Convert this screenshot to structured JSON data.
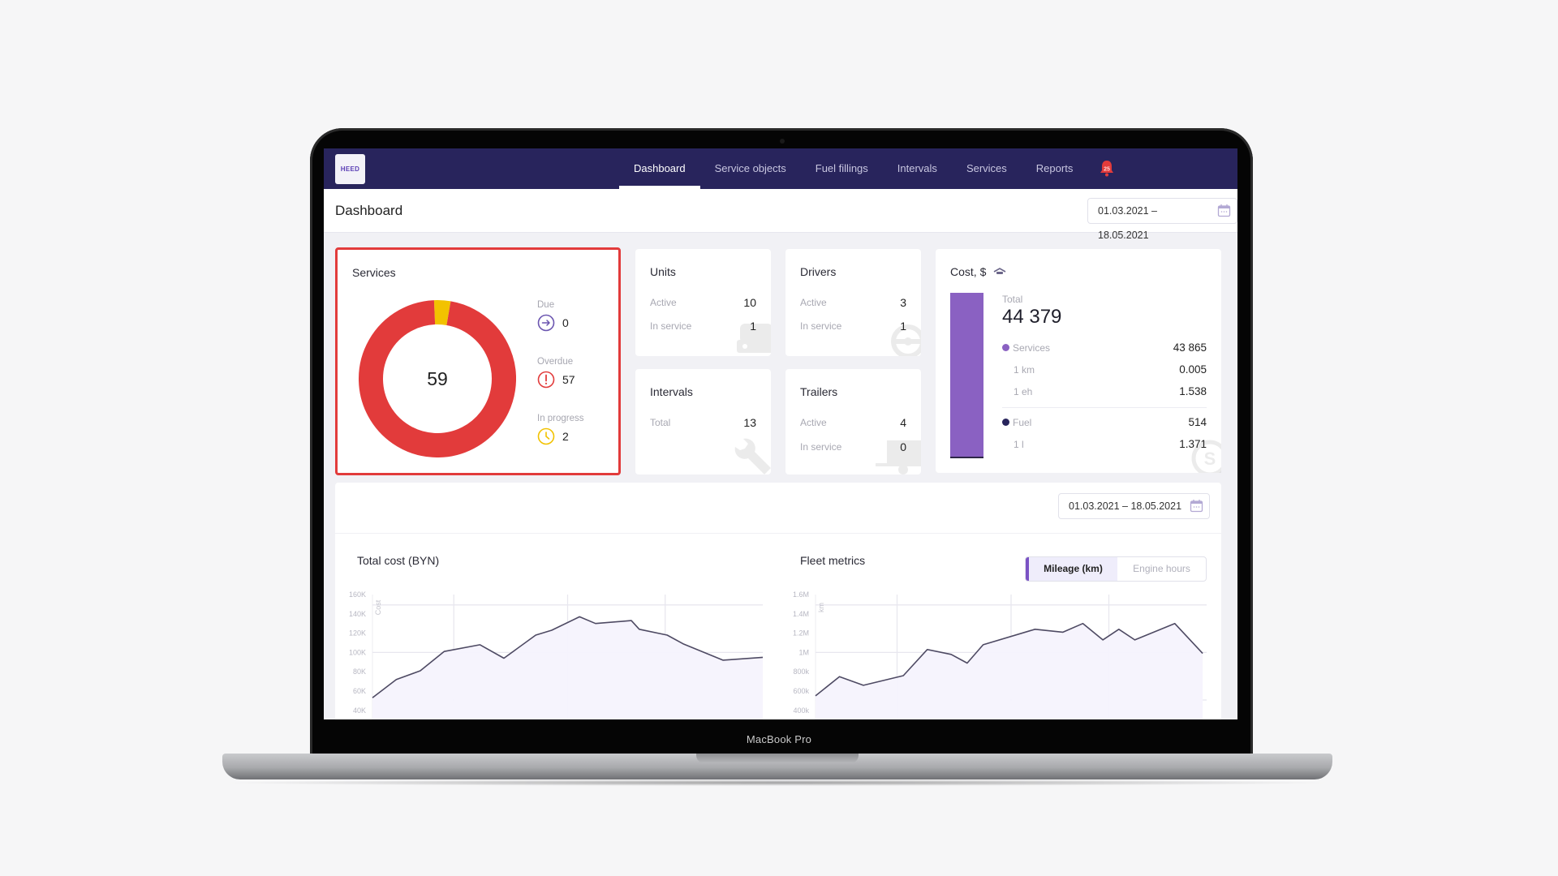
{
  "device": {
    "label": "MacBook Pro"
  },
  "app": {
    "logo_text": "HEED",
    "nav": [
      {
        "label": "Dashboard",
        "active": true
      },
      {
        "label": "Service objects",
        "active": false
      },
      {
        "label": "Fuel fillings",
        "active": false
      },
      {
        "label": "Intervals",
        "active": false
      },
      {
        "label": "Services",
        "active": false
      },
      {
        "label": "Reports",
        "active": false
      }
    ],
    "notifications": {
      "icon": "bell-icon",
      "count": "25"
    },
    "page_title": "Dashboard",
    "date_range": "01.03.2021 – 18.05.2021"
  },
  "services": {
    "title": "Services",
    "total": "59",
    "due": {
      "label": "Due",
      "value": "0",
      "icon": "arrow-right-circle-icon",
      "color": "#6b55b0"
    },
    "overdue": {
      "label": "Overdue",
      "value": "57",
      "icon": "exclamation-circle-icon",
      "color": "#e23b3b"
    },
    "in_progress": {
      "label": "In progress",
      "value": "2",
      "icon": "clock-icon",
      "color": "#f2c200"
    },
    "segments": [
      {
        "name": "Overdue",
        "value": 57,
        "color": "#e23b3b"
      },
      {
        "name": "In progress",
        "value": 2,
        "color": "#f2c200"
      }
    ]
  },
  "units": {
    "title": "Units",
    "active_label": "Active",
    "active": "10",
    "in_service_label": "In service",
    "in_service": "1"
  },
  "drivers": {
    "title": "Drivers",
    "active_label": "Active",
    "active": "3",
    "in_service_label": "In service",
    "in_service": "1"
  },
  "intervals": {
    "title": "Intervals",
    "total_label": "Total",
    "total": "13"
  },
  "trailers": {
    "title": "Trailers",
    "active_label": "Active",
    "active": "4",
    "in_service_label": "In service",
    "in_service": "0"
  },
  "cost": {
    "title": "Cost, $",
    "total_label": "Total",
    "total": "44 379",
    "services_label": "Services",
    "services": "43 865",
    "per_km_label": "1 km",
    "per_km": "0.005",
    "per_eh_label": "1 eh",
    "per_eh": "1.538",
    "fuel_label": "Fuel",
    "fuel": "514",
    "per_l_label": "1 l",
    "per_l": "1.371",
    "services_color": "#8a61c2",
    "fuel_color": "#28245c"
  },
  "charts_panel": {
    "date_range": "01.03.2021 – 18.05.2021",
    "toggle": [
      {
        "label": "Mileage (km)",
        "active": true
      },
      {
        "label": "Engine hours",
        "active": false
      }
    ]
  },
  "chart_data": [
    {
      "type": "area",
      "title": "Total cost (BYN)",
      "xlabel": "",
      "ylabel": "Cost",
      "ylim": [
        20000,
        160000
      ],
      "yticks": [
        "160K",
        "140K",
        "120K",
        "100K",
        "80K",
        "60K",
        "40K"
      ],
      "ytick_values": [
        160000,
        140000,
        120000,
        100000,
        80000,
        60000,
        40000
      ],
      "grid": true,
      "x": [
        0,
        6,
        12,
        18,
        27,
        33,
        41,
        45,
        52,
        56,
        65,
        67,
        74,
        78,
        88,
        98
      ],
      "values": [
        53000,
        72000,
        81000,
        101000,
        108000,
        94000,
        118000,
        123000,
        137000,
        130000,
        133000,
        124000,
        118000,
        109000,
        92000,
        95000
      ],
      "line_color": "#4e4a63",
      "fill_color": "#f5f3fd"
    },
    {
      "type": "area",
      "title": "Fleet metrics",
      "xlabel": "",
      "ylabel": "km",
      "ylim": [
        200000,
        1600000
      ],
      "yticks": [
        "1.6M",
        "1.4M",
        "1.2M",
        "1M",
        "800k",
        "600k",
        "400k"
      ],
      "ytick_values": [
        1600000,
        1400000,
        1200000,
        1000000,
        800000,
        600000,
        400000
      ],
      "grid": true,
      "x": [
        0,
        6,
        12,
        22,
        28,
        34,
        38,
        42,
        55,
        62,
        67,
        72,
        76,
        80,
        90,
        97
      ],
      "values": [
        550000,
        750000,
        660000,
        760000,
        1030000,
        980000,
        890000,
        1080000,
        1240000,
        1210000,
        1300000,
        1130000,
        1240000,
        1130000,
        1300000,
        990000
      ],
      "line_color": "#4e4a63",
      "fill_color": "#f5f3fd"
    }
  ]
}
